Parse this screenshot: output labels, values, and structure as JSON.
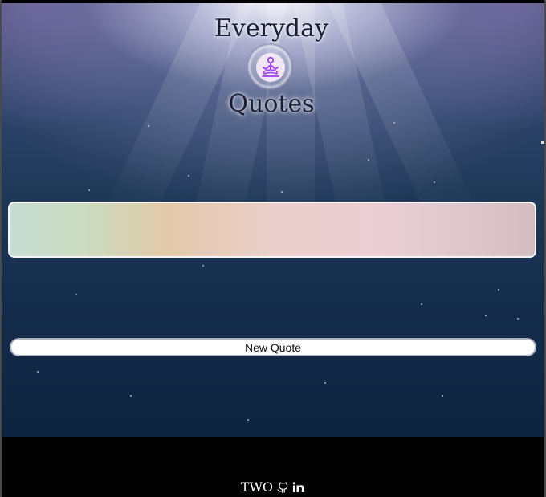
{
  "header": {
    "title_top": "Everyday",
    "title_bottom": "Quotes",
    "logo": "meditation-icon"
  },
  "quote": {
    "text": ""
  },
  "controls": {
    "new_quote_label": "New Quote"
  },
  "footer": {
    "text": "TWO",
    "icons": [
      "github-icon",
      "linkedin-icon"
    ]
  },
  "colors": {
    "logo_accent": "#9b3ef0",
    "button_border": "#a9b3c4"
  }
}
